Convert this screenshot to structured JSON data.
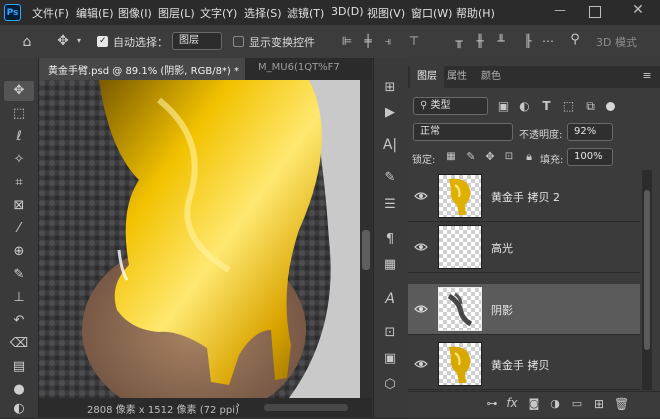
{
  "app": {
    "logo_text": "Ps"
  },
  "menu": [
    "文件(F)",
    "编辑(E)",
    "图像(I)",
    "图层(L)",
    "文字(Y)",
    "选择(S)",
    "滤镜(T)",
    "3D(D)",
    "视图(V)",
    "窗口(W)",
    "帮助(H)"
  ],
  "options_bar": {
    "auto_select_label": "自动选择：",
    "auto_select_checked": true,
    "auto_select_target": "图层",
    "show_transform_label": "显示变换控件",
    "show_transform_checked": false,
    "mode_3d_label": "3D 模式"
  },
  "documents": {
    "tabs": [
      {
        "label": "黄金手臂.psd @ 89.1% (阴影, RGB/8*) *",
        "active": true
      },
      {
        "label": "M_MU6(1QT%F7",
        "active": false
      }
    ]
  },
  "status": {
    "dimensions": "2808 像素 x 1512 像素 (72 ppi)"
  },
  "panel": {
    "tabs": [
      "图层",
      "属性",
      "颜色"
    ],
    "filter_kind": "类型",
    "blend_mode": "正常",
    "opacity_label": "不透明度:",
    "opacity_value": "92%",
    "lock_label": "锁定:",
    "fill_label": "填充:",
    "fill_value": "100%",
    "layers": [
      {
        "name": "黄金手 拷贝 2",
        "visible": true,
        "selected": false,
        "thumb": "gold"
      },
      {
        "name": "高光",
        "visible": true,
        "selected": false,
        "thumb": "empty"
      },
      {
        "name": "阴影",
        "visible": true,
        "selected": true,
        "thumb": "shadow"
      },
      {
        "name": "黄金手 拷贝",
        "visible": true,
        "selected": false,
        "thumb": "gold"
      }
    ]
  },
  "colors": {
    "accent": "#31a8ff",
    "gold": "#f2c200",
    "selected_row": "#5b5b5b"
  }
}
